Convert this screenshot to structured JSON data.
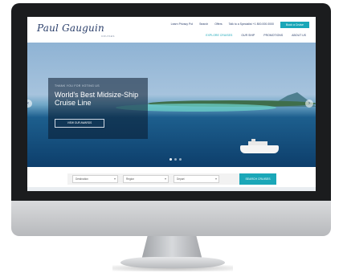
{
  "brand": {
    "logo_text": "Paul Gauguin",
    "logo_sub": "CRUISES"
  },
  "header": {
    "top_links": [
      "Learn Privacy Pol",
      "Search",
      "Offers",
      "Talk to a Specialist +1 800.000.0000"
    ],
    "book_button": "Book a Cruise",
    "nav_items": [
      "EXPLORE CRUISES",
      "OUR SHIP",
      "PROMOTIONS",
      "ABOUT US"
    ]
  },
  "hero": {
    "pretitle": "THANK YOU FOR VOTING US",
    "title": "World's Best Midsize-Ship Cruise Line",
    "cta": "VIEW OUR AWARDS",
    "slides_total": 3,
    "active_slide": 1
  },
  "search": {
    "fields": [
      "Destination",
      "Region",
      "Depart"
    ],
    "button": "SEARCH CRUISES"
  },
  "colors": {
    "accent": "#1aa7b8",
    "brand": "#2a3e6a"
  }
}
